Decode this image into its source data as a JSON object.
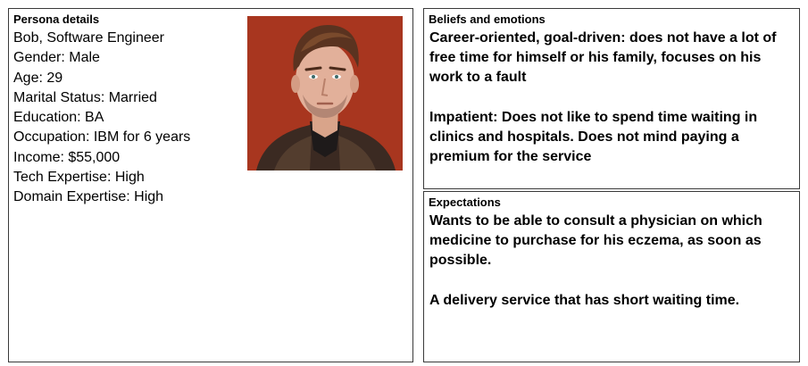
{
  "persona": {
    "title": "Persona details",
    "lines": [
      "Bob, Software Engineer",
      "Gender: Male",
      "Age: 29",
      "Marital Status: Married",
      "Education: BA",
      "Occupation: IBM for 6 years",
      "Income: $55,000",
      "Tech Expertise: High",
      "Domain Expertise: High"
    ],
    "photo_icon": "portrait-photo"
  },
  "beliefs": {
    "title": "Beliefs and emotions",
    "paragraphs": [
      "Career-oriented, goal-driven: does not have a lot of free time for himself or his family, focuses on his work to a fault",
      "Impatient: Does not like to spend time waiting in clinics and hospitals. Does not mind paying a premium for the service"
    ]
  },
  "expectations": {
    "title": "Expectations",
    "paragraphs": [
      "Wants to be able to consult a physician on which medicine to purchase for his eczema, as soon as possible.",
      "A delivery service that has short waiting time."
    ]
  },
  "colors": {
    "border": "#3a3a3a",
    "photo_background": "#b13a22",
    "text": "#000000"
  }
}
